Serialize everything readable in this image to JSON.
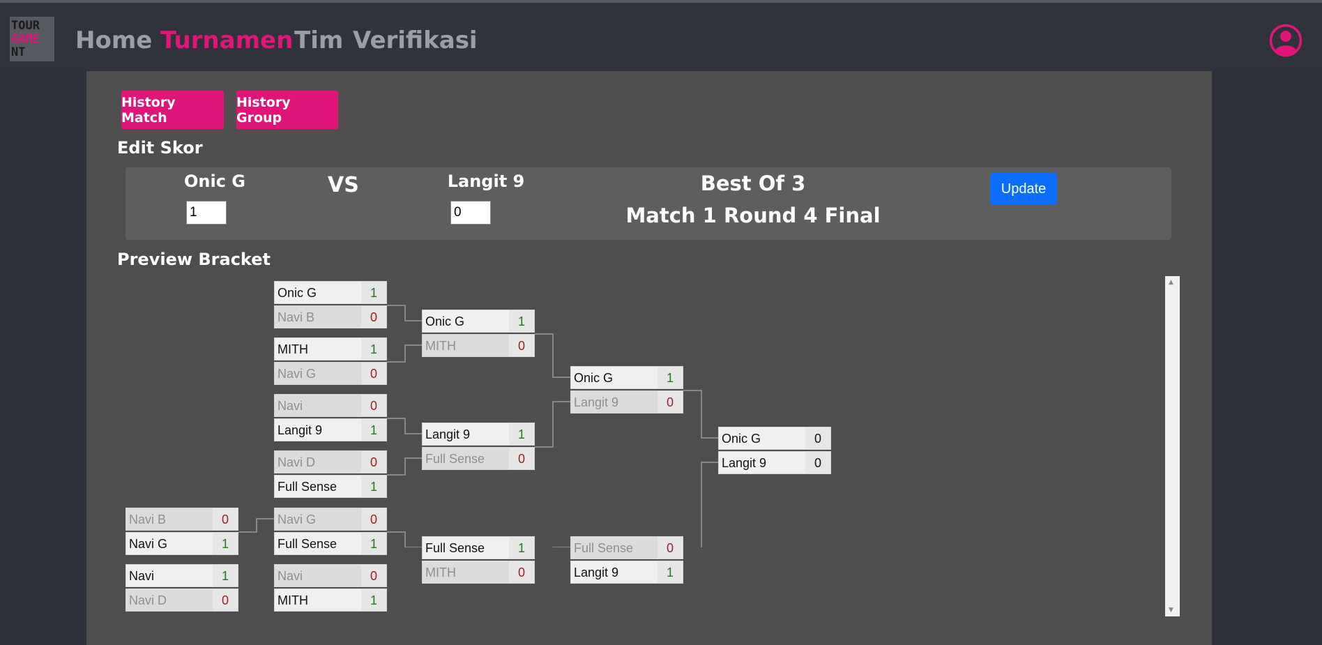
{
  "nav": {
    "logo": {
      "line1": "TOUR",
      "line2": "GAME",
      "line3": "NT"
    },
    "links": [
      {
        "label": "Home",
        "active": false
      },
      {
        "label": "Turnamen",
        "active": true
      },
      {
        "label": "Tim",
        "active": false
      },
      {
        "label": "Verifikasi",
        "active": false
      }
    ],
    "profile_icon": "user-circle-icon"
  },
  "colors": {
    "accent": "#e0157a",
    "update_button": "#0d6efd",
    "win": "#1f7a1f",
    "lose": "#9a1f1f"
  },
  "buttons": {
    "history_match": "History Match",
    "history_group": "History Group"
  },
  "edit": {
    "title": "Edit Skor",
    "team1": {
      "name": "Onic G",
      "score": "1"
    },
    "vs": "VS",
    "team2": {
      "name": "Langit 9",
      "score": "0"
    },
    "best_of": "Best Of 3",
    "match_info": "Match 1 Round 4 Final",
    "update_label": "Update"
  },
  "bracket": {
    "title": "Preview Bracket",
    "matches": [
      {
        "id": "r0m0",
        "teams": [
          {
            "name": "Navi B",
            "score": "0",
            "result": "lose"
          },
          {
            "name": "Navi G",
            "score": "1",
            "result": "win"
          }
        ]
      },
      {
        "id": "r0m1",
        "teams": [
          {
            "name": "Navi",
            "score": "1",
            "result": "win"
          },
          {
            "name": "Navi D",
            "score": "0",
            "result": "lose"
          }
        ]
      },
      {
        "id": "r1m0",
        "teams": [
          {
            "name": "Onic G",
            "score": "1",
            "result": "win"
          },
          {
            "name": "Navi B",
            "score": "0",
            "result": "lose"
          }
        ]
      },
      {
        "id": "r1m1",
        "teams": [
          {
            "name": "MITH",
            "score": "1",
            "result": "win"
          },
          {
            "name": "Navi G",
            "score": "0",
            "result": "lose"
          }
        ]
      },
      {
        "id": "r1m2",
        "teams": [
          {
            "name": "Navi",
            "score": "0",
            "result": "lose"
          },
          {
            "name": "Langit 9",
            "score": "1",
            "result": "win"
          }
        ]
      },
      {
        "id": "r1m3",
        "teams": [
          {
            "name": "Navi D",
            "score": "0",
            "result": "lose"
          },
          {
            "name": "Full Sense",
            "score": "1",
            "result": "win"
          }
        ]
      },
      {
        "id": "r1m4",
        "teams": [
          {
            "name": "Navi G",
            "score": "0",
            "result": "lose"
          },
          {
            "name": "Full Sense",
            "score": "1",
            "result": "win"
          }
        ]
      },
      {
        "id": "r1m5",
        "teams": [
          {
            "name": "Navi",
            "score": "0",
            "result": "lose"
          },
          {
            "name": "MITH",
            "score": "1",
            "result": "win"
          }
        ]
      },
      {
        "id": "r2m0",
        "teams": [
          {
            "name": "Onic G",
            "score": "1",
            "result": "win"
          },
          {
            "name": "MITH",
            "score": "0",
            "result": "lose"
          }
        ]
      },
      {
        "id": "r2m1",
        "teams": [
          {
            "name": "Langit 9",
            "score": "1",
            "result": "win"
          },
          {
            "name": "Full Sense",
            "score": "0",
            "result": "lose"
          }
        ]
      },
      {
        "id": "r2m2",
        "teams": [
          {
            "name": "Full Sense",
            "score": "1",
            "result": "win"
          },
          {
            "name": "MITH",
            "score": "0",
            "result": "lose"
          }
        ]
      },
      {
        "id": "r3m0",
        "teams": [
          {
            "name": "Onic G",
            "score": "1",
            "result": "win"
          },
          {
            "name": "Langit 9",
            "score": "0",
            "result": "lose"
          }
        ]
      },
      {
        "id": "r3m1",
        "teams": [
          {
            "name": "Full Sense",
            "score": "0",
            "result": "lose"
          },
          {
            "name": "Langit 9",
            "score": "1",
            "result": "win"
          }
        ]
      },
      {
        "id": "r4m0",
        "teams": [
          {
            "name": "Onic G",
            "score": "0",
            "result": "none"
          },
          {
            "name": "Langit 9",
            "score": "0",
            "result": "none"
          }
        ]
      }
    ]
  }
}
